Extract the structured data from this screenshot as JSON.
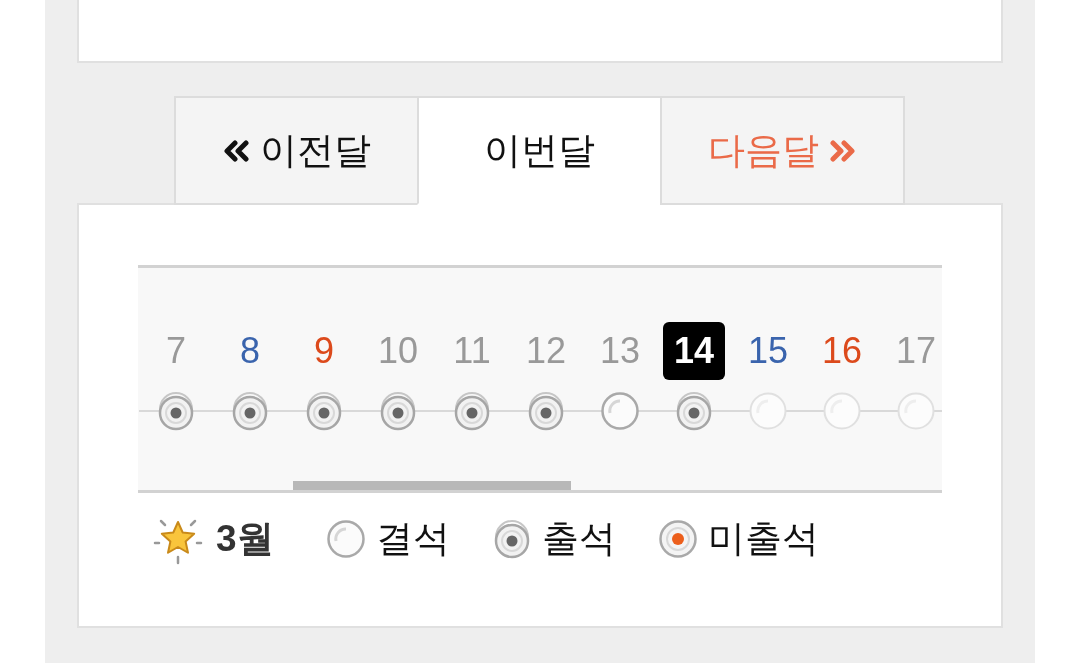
{
  "tabs": [
    {
      "kind": "prev",
      "label": "이전달",
      "selected": false
    },
    {
      "kind": "current",
      "label": "이번달",
      "selected": true
    },
    {
      "kind": "next",
      "label": "다음달",
      "selected": false
    }
  ],
  "calendar": {
    "days": [
      {
        "day": "7",
        "color": "#999999",
        "today": false,
        "kind": "attended"
      },
      {
        "day": "8",
        "color": "#3a64ad",
        "today": false,
        "kind": "attended"
      },
      {
        "day": "9",
        "color": "#dc4a1c",
        "today": false,
        "kind": "attended"
      },
      {
        "day": "10",
        "color": "#999999",
        "today": false,
        "kind": "attended"
      },
      {
        "day": "11",
        "color": "#999999",
        "today": false,
        "kind": "attended"
      },
      {
        "day": "12",
        "color": "#999999",
        "today": false,
        "kind": "attended"
      },
      {
        "day": "13",
        "color": "#999999",
        "today": false,
        "kind": "absent"
      },
      {
        "day": "14",
        "today": true,
        "kind": "attended"
      },
      {
        "day": "15",
        "color": "#3a64ad",
        "today": false,
        "kind": "upcoming"
      },
      {
        "day": "16",
        "color": "#dc4a1c",
        "today": false,
        "kind": "upcoming"
      },
      {
        "day": "17",
        "color": "#999999",
        "today": false,
        "kind": "upcoming"
      }
    ]
  },
  "legend": {
    "month": "3월",
    "items": [
      {
        "kind": "absent",
        "label": "결석"
      },
      {
        "kind": "attended",
        "label": "출석"
      },
      {
        "kind": "pending",
        "label": "미출석"
      }
    ]
  }
}
